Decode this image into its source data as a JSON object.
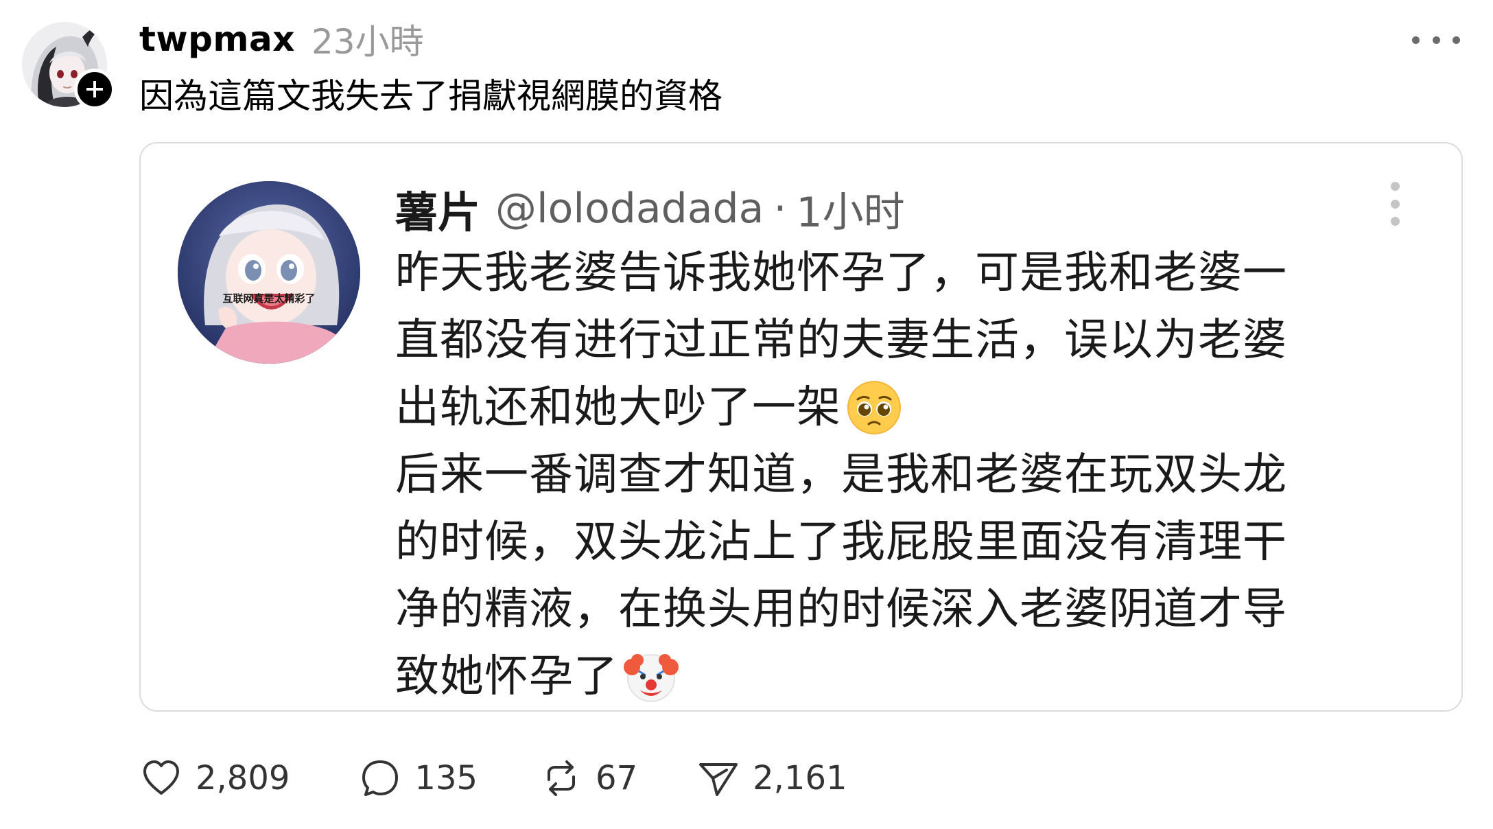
{
  "post": {
    "username": "twpmax",
    "timestamp": "23小時",
    "text": "因為這篇文我失去了捐獻視網膜的資格"
  },
  "embed": {
    "name": "薯片",
    "handle": "@lolodadada",
    "separator": "·",
    "time": "1小时",
    "avatar_caption": "互联网真是太精彩了",
    "lines": [
      "昨天我老婆告诉我她怀孕了，可是我和老婆一",
      "直都没有进行过正常的夫妻生活，误以为老婆",
      "出轨还和她大吵了一架",
      "后来一番调查才知道，是我和老婆在玩双头龙",
      "的时候，双头龙沾上了我屁股里面没有清理干",
      "净的精液，在换头用的时候深入老婆阴道才导",
      "致她怀孕了"
    ],
    "emoji_line3": "pleading-face-emoji",
    "emoji_line7": "clown-face-emoji"
  },
  "actions": {
    "likes": "2,809",
    "replies": "135",
    "reposts": "67",
    "shares": "2,161"
  },
  "icons": {
    "like": "heart-icon",
    "reply": "speech-bubble-icon",
    "repost": "repost-arrows-icon",
    "share": "paper-plane-icon",
    "follow": "plus-icon",
    "more": "ellipsis-icon"
  },
  "colors": {
    "text": "#000000",
    "muted": "#9a9a9a",
    "embed_border": "#dcdcdc",
    "embed_text": "#1a1a1a"
  }
}
